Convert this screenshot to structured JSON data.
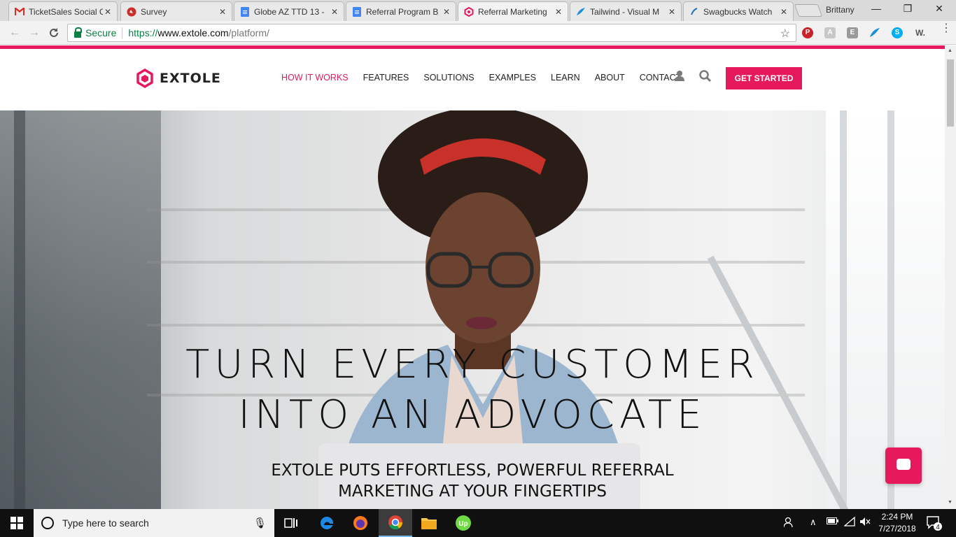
{
  "browser": {
    "tabs": [
      {
        "label": "TicketSales Social C",
        "icon": "gmail-icon",
        "active": false
      },
      {
        "label": "Survey",
        "icon": "survey-icon",
        "active": false
      },
      {
        "label": "Globe AZ TTD 13 -",
        "icon": "docs-icon",
        "active": false
      },
      {
        "label": "Referral Program B",
        "icon": "docs-icon",
        "active": false
      },
      {
        "label": "Referral Marketing",
        "icon": "extole-icon",
        "active": true
      },
      {
        "label": "Tailwind - Visual M",
        "icon": "tailwind-icon",
        "active": false
      },
      {
        "label": "Swagbucks Watch",
        "icon": "swagbucks-icon",
        "active": false
      }
    ],
    "tab_close": "✕",
    "profile_name": "Brittany",
    "window_controls": {
      "minimize": "—",
      "maximize": "❐",
      "close": "✕"
    },
    "security_label": "Secure",
    "url": {
      "scheme": "https://",
      "host": "www.extole.com",
      "path": "/platform/"
    },
    "extensions": [
      "pinterest-icon",
      "pdf-icon",
      "evernote-icon",
      "tailwind-icon",
      "skype-icon",
      "wordtune-icon"
    ],
    "wordtune_label": "W.",
    "menu_icon": "⋮"
  },
  "site": {
    "logo_text": "EXTOLE",
    "nav": [
      "HOW IT WORKS",
      "FEATURES",
      "SOLUTIONS",
      "EXAMPLES",
      "LEARN",
      "ABOUT",
      "CONTACT"
    ],
    "active_nav": "HOW IT WORKS",
    "cta_label": "GET STARTED",
    "accent_color": "#e5195b",
    "hero_title_line1": "TURN EVERY CUSTOMER",
    "hero_title_line2": "INTO AN ADVOCATE",
    "hero_sub_line1": "EXTOLE PUTS EFFORTLESS, POWERFUL REFERRAL",
    "hero_sub_line2": "MARKETING AT YOUR FINGERTIPS"
  },
  "taskbar": {
    "search_placeholder": "Type here to search",
    "apps": [
      "task-view-icon",
      "edge-icon",
      "firefox-icon",
      "chrome-icon",
      "file-explorer-icon",
      "upwork-icon"
    ],
    "upwork_label": "Up",
    "time": "2:24 PM",
    "date": "7/27/2018",
    "notification_count": "4"
  }
}
